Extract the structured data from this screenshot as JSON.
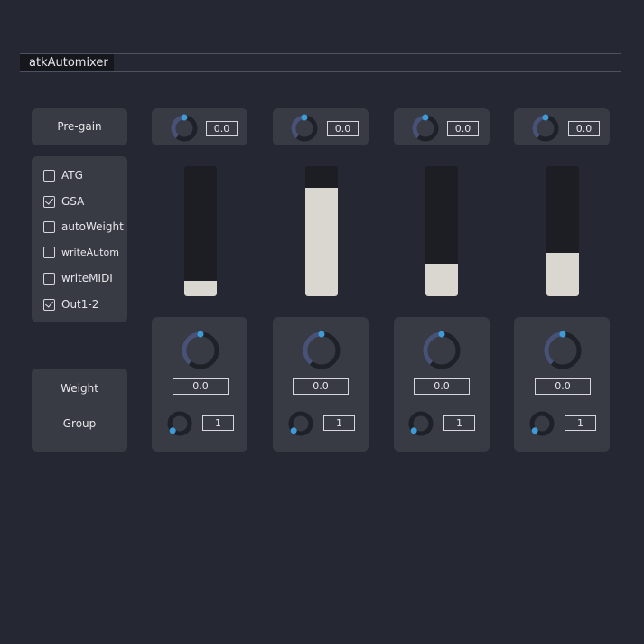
{
  "window": {
    "title": "atkAutomixer"
  },
  "left_panel": {
    "pregain_label": "Pre-gain",
    "options": [
      {
        "label": "ATG",
        "checked": false
      },
      {
        "label": "GSA",
        "checked": true
      },
      {
        "label": "autoWeight",
        "checked": false
      },
      {
        "label": "writeAutom",
        "checked": false
      },
      {
        "label": "writeMIDI",
        "checked": false
      },
      {
        "label": "Out1-2",
        "checked": true
      }
    ],
    "weight_label": "Weight",
    "group_label": "Group"
  },
  "channels": [
    {
      "pregain": "0.0",
      "fader_level": 0.12,
      "weight": "0.0",
      "group": "1"
    },
    {
      "pregain": "0.0",
      "fader_level": 0.83,
      "weight": "0.0",
      "group": "1"
    },
    {
      "pregain": "0.0",
      "fader_level": 0.25,
      "weight": "0.0",
      "group": "1"
    },
    {
      "pregain": "0.0",
      "fader_level": 0.33,
      "weight": "0.0",
      "group": "1"
    }
  ],
  "colors": {
    "background": "#252833",
    "panel": "#383a44",
    "knob_accent": "#3d9bd6",
    "knob_arc": "#485277",
    "knob_track": "#1f2128",
    "fader_fill": "#d9d7cf"
  },
  "icons": {
    "knob": "rotary-knob-icon",
    "checkbox": "checkbox-icon"
  }
}
